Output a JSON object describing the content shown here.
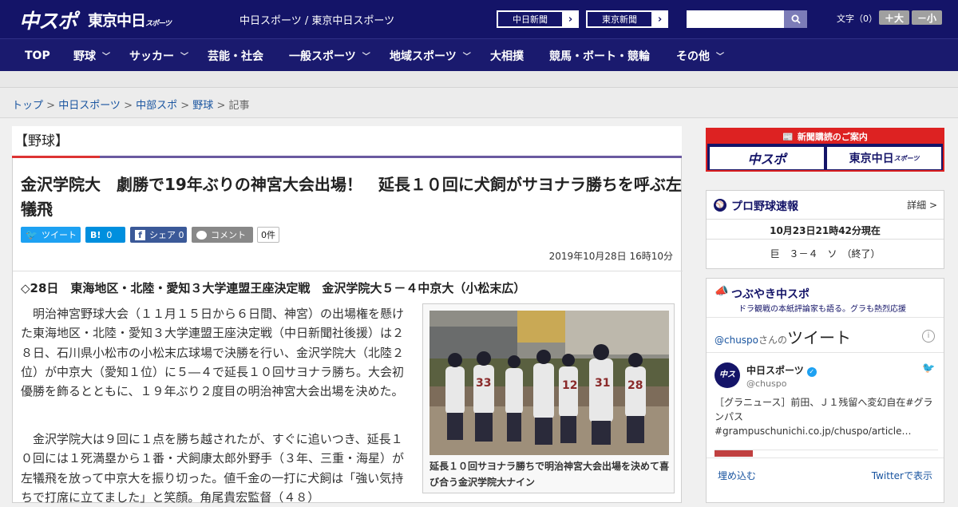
{
  "header": {
    "logo1": "中スポ",
    "logo2": "東京中日",
    "logo2_small": "スポーツ",
    "site_line": "中日スポーツ / 東京中日スポーツ",
    "paper1": "中日新聞",
    "paper2": "東京新聞",
    "font_label": "文字（0）",
    "font_large": "＋大",
    "font_small": "－小",
    "search_placeholder": ""
  },
  "nav": [
    "TOP",
    "野球",
    "サッカー",
    "芸能・社会",
    "一般スポーツ",
    "地域スポーツ",
    "大相撲",
    "競馬・ボート・競輪",
    "その他"
  ],
  "breadcrumb": [
    "トップ",
    "中日スポーツ",
    "中部スポ",
    "野球",
    "記事"
  ],
  "category": "【野球】",
  "article": {
    "headline": "金沢学院大　劇勝で19年ぶりの神宮大会出場！　延長１０回に犬飼がサヨナラ勝ちを呼ぶ左犠飛",
    "share": {
      "tweet": "ツイート",
      "hatena": "0",
      "facebook": "シェア 0",
      "comment": "コメント",
      "count": "0件"
    },
    "date": "2019年10月28日 16時10分",
    "lead": "◇28日　東海地区・北陸・愛知３大学連盟王座決定戦　金沢学院大５－４中京大（小松末広）",
    "p1": "　明治神宮野球大会（１１月１５日から６日間、神宮）の出場権を懸けた東海地区・北陸・愛知３大学連盟王座決定戦（中日新聞社後援）は２８日、石川県小松市の小松末広球場で決勝を行い、金沢学院大（北陸２位）が中京大（愛知１位）に５―４で延長１０回サヨナラ勝ち。大会初優勝を飾るとともに、１９年ぶり２度目の明治神宮大会出場を決めた。",
    "p2": "　金沢学院大は９回に１点を勝ち越されたが、すぐに追いつき、延長１０回には１死満塁から１番・犬飼康太郎外野手（３年、三重・海星）が左犠飛を放って中京大を振り切った。値千金の一打に犬飼は「強い気持ちで打席に立てました」と笑顔。角尾貴宏監督（４８）",
    "caption": "延長１０回サヨナラ勝ちで明治神宮大会出場を決めて喜び合う金沢学院大ナイン"
  },
  "sidebar": {
    "ad_title": "新聞購読のご案内",
    "ad_btn1": "中スポ",
    "ad_btn2": "東京中日",
    "ad_btn2_small": "スポーツ",
    "baseball_title": "プロ野球速報",
    "baseball_more": "詳細 >",
    "baseball_time": "10月23日21時42分現在",
    "baseball_score": "巨　３－４　ソ　（終了）",
    "tweet_title": "つぶやき中スポ",
    "tweet_sub": "ドラ観戦の本紙評論家も語る。グラも熱烈応援",
    "tweet_handle_prefix": "@chuspo",
    "tweet_handle_suffix": "さんの",
    "tweet_heading": "ツイート",
    "tweet_name": "中日スポーツ",
    "tweet_user": "@chuspo",
    "tweet_text": "［グラニュース］前田、Ｊ１残留へ変幻自在#グランパス #grampuschunichi.co.jp/chuspo/article…",
    "embed": "埋め込む",
    "view": "Twitterで表示"
  }
}
